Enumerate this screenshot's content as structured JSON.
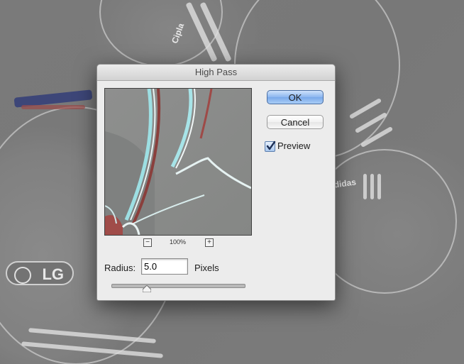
{
  "background": {
    "logo_text": "LG",
    "jersey_text": "Cipla",
    "brand_text": "adidas"
  },
  "dialog": {
    "title": "High Pass",
    "ok_label": "OK",
    "cancel_label": "Cancel",
    "preview_label": "Preview",
    "preview_checked": true,
    "zoom_level": "100%",
    "zoom_out_label": "−",
    "zoom_in_label": "+",
    "radius_label": "Radius:",
    "radius_value": "5.0",
    "units_label": "Pixels",
    "radius_slider_fraction": 0.27
  },
  "colors": {
    "ok_accent": "#79a8ea",
    "dialog_bg": "#ececec",
    "checkbox_accent": "#5a7dad"
  }
}
